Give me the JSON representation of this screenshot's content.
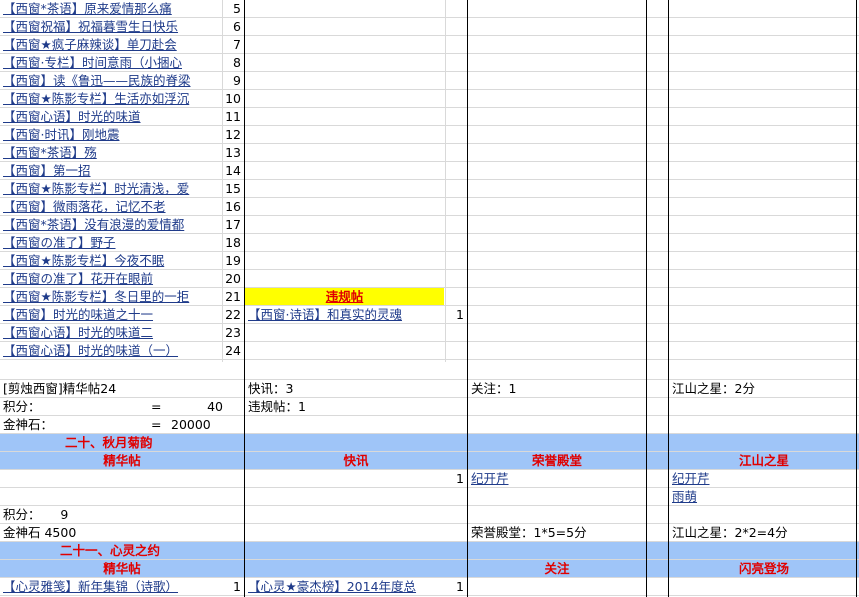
{
  "posts": [
    {
      "title": "【西窗*茶语】原来爱情那么痛",
      "n": "5"
    },
    {
      "title": "【西窗祝福】祝福暮雪生日快乐",
      "n": "6"
    },
    {
      "title": "【西窗★疯子麻辣谈】单刀赴会",
      "n": "7"
    },
    {
      "title": "【西窗·专栏】时间意雨（小捆心",
      "n": "8"
    },
    {
      "title": "【西窗】读《鲁迅——民族的脊梁",
      "n": "9"
    },
    {
      "title": "【西窗★陈影专栏】生活亦如浮沉",
      "n": "10"
    },
    {
      "title": "【西窗心语】时光的味道",
      "n": "11"
    },
    {
      "title": "【西窗·时讯】刚地震",
      "n": "12"
    },
    {
      "title": "【西窗*茶语】殇",
      "n": "13"
    },
    {
      "title": "【西窗】第一招",
      "n": "14"
    },
    {
      "title": "【西窗★陈影专栏】时光清浅，爱",
      "n": "15"
    },
    {
      "title": "【西窗】微雨落花，记忆不老",
      "n": "16"
    },
    {
      "title": "【西窗*茶语】没有浪漫的爱情都",
      "n": "17"
    },
    {
      "title": "【西窗の准了】野子",
      "n": "18"
    },
    {
      "title": "【西窗★陈影专栏】今夜不眠",
      "n": "19"
    },
    {
      "title": "【西窗の准了】花开在眼前",
      "n": "20"
    },
    {
      "title": "【西窗★陈影专栏】冬日里的一拒",
      "n": "21"
    },
    {
      "title": "【西窗】时光的味道之十一",
      "n": "22"
    },
    {
      "title": "【西窗心语】时光的味道二",
      "n": "23"
    },
    {
      "title": "【西窗心语】时光的味道（一）",
      "n": "24"
    }
  ],
  "violation": {
    "label": "违规帖",
    "title": "【西窗·诗语】和真实的灵魂",
    "n": "1"
  },
  "summary1": {
    "jinghua": "[剪烛西窗]精华帖24",
    "kuaixun": "快讯：3",
    "guanzhu": "关注：1",
    "jiangshan": "江山之星：2分",
    "jifen_label": "积分：",
    "eq1": "=",
    "jifen_val": "40",
    "weigui": "违规帖：1",
    "jinshen_label": "金神石：",
    "eq2": "=",
    "jinshen_val": "20000"
  },
  "section20": {
    "title": "二十、秋月菊韵",
    "h_jinghua": "精华帖",
    "h_kuaixun": "快讯",
    "h_rongyu": "荣誉殿堂",
    "h_jiangshan": "江山之星",
    "rongyu_n": "1",
    "rongyu_name": "纪开芹",
    "star1": "纪开芹",
    "star2": "雨萌",
    "jifen": "积分：     9",
    "jinshen": "金神石  4500",
    "rongyu_sum": "荣誉殿堂：1*5=5分",
    "jiangshan_sum": "江山之星：2*2=4分"
  },
  "section21": {
    "title": "二十一、心灵之约",
    "h_jinghua": "精华帖",
    "h_guanzhu": "关注",
    "h_shanliang": "闪亮登场",
    "post1": "【心灵雅笺】新年集锦（诗歌）",
    "post1_n": "1",
    "post2": "【心灵★豪杰榜】2014年度总",
    "post2_n": "1"
  }
}
